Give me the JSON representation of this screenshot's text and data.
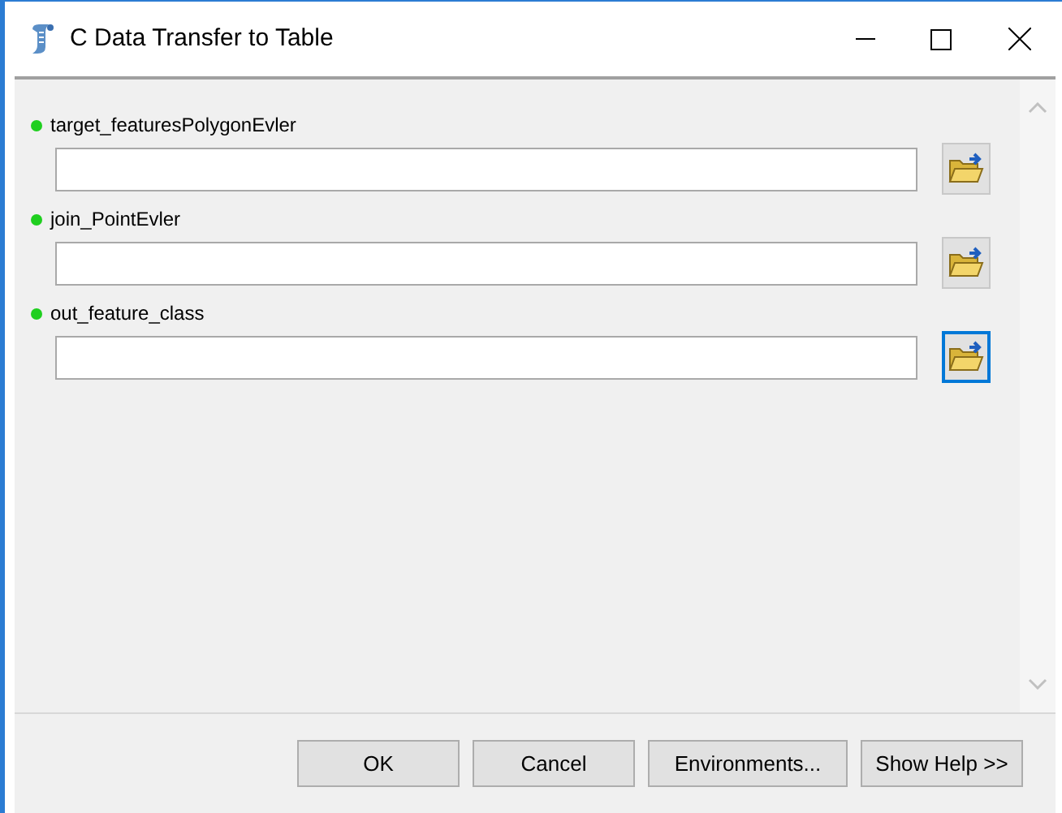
{
  "window": {
    "title": "C Data Transfer to Table"
  },
  "parameters": [
    {
      "label": "target_featuresPolygonEvler",
      "browse_focused": false
    },
    {
      "label": "join_PointEvler",
      "browse_focused": false
    },
    {
      "label": "out_feature_class",
      "browse_focused": true
    }
  ],
  "buttons": [
    "OK",
    "Cancel",
    "Environments...",
    "Show Help >>"
  ]
}
